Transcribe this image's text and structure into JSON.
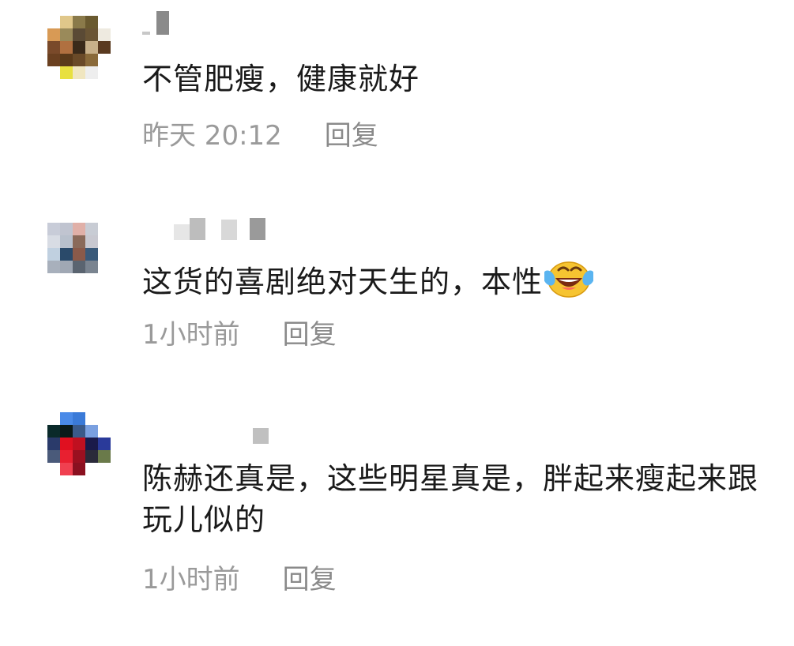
{
  "comments": [
    {
      "text": "不管肥瘦，健康就好",
      "time": "昨天 20:12",
      "reply_label": "回复",
      "avatar_colors": [
        "#ffffff",
        "#e0c78a",
        "#8a7a4a",
        "#6a5a30",
        "#ffffff",
        "#ffffff",
        "#d89a55",
        "#9a8a5a",
        "#5a4a35",
        "#6a5535",
        "#eeeae0",
        "#ffffff",
        "#7a4a2a",
        "#b07040",
        "#3a2a1a",
        "#c8b08a",
        "#5a3a20",
        "#ffffff",
        "#6a4020",
        "#5a3a1a",
        "#6a4a28",
        "#8a6a3a",
        "#ffffff",
        "#ffffff",
        "#ffffff",
        "#e8e040",
        "#f0e6c0",
        "#eeeeee",
        "#ffffff",
        "#ffffff",
        "#ffffff",
        "#ffffff",
        "#ffffff",
        "#ffffff",
        "#ffffff",
        "#ffffff"
      ]
    },
    {
      "text": "这货的喜剧绝对天生的，本性",
      "emoji": "laughing-crying-emoji",
      "time": "1小时前",
      "reply_label": "回复",
      "avatar_colors": [
        "#c8ccd8",
        "#c0c4d0",
        "#e0b0a8",
        "#c8ccd4",
        "#ffffff",
        "#ffffff",
        "#d8dce4",
        "#b8c0cc",
        "#8a6a5a",
        "#c8c8d0",
        "#ffffff",
        "#ffffff",
        "#c0d0e0",
        "#2a4a6a",
        "#8a5a4a",
        "#3a5a7a",
        "#ffffff",
        "#ffffff",
        "#a8b0bc",
        "#a0a8b4",
        "#5a6470",
        "#7a8490",
        "#ffffff",
        "#ffffff",
        "#ffffff",
        "#ffffff",
        "#ffffff",
        "#ffffff",
        "#ffffff",
        "#ffffff",
        "#ffffff",
        "#ffffff",
        "#ffffff",
        "#ffffff",
        "#ffffff",
        "#ffffff"
      ]
    },
    {
      "text": "陈赫还真是，这些明星真是，胖起来瘦起来跟玩儿似的",
      "time": "1小时前",
      "reply_label": "回复",
      "avatar_colors": [
        "#ffffff",
        "#4a8ae8",
        "#3a7ad8",
        "#ffffff",
        "#ffffff",
        "#ffffff",
        "#0a2a2a",
        "#0a1a1a",
        "#3a5a8a",
        "#7aa0e0",
        "#ffffff",
        "#ffffff",
        "#2a3a6a",
        "#e01020",
        "#c01020",
        "#1a1a4a",
        "#2a3a9a",
        "#ffffff",
        "#4a5a7a",
        "#e82030",
        "#9a1020",
        "#2a2a3a",
        "#6a7a4a",
        "#ffffff",
        "#ffffff",
        "#f04050",
        "#8a1020",
        "#ffffff",
        "#ffffff",
        "#ffffff",
        "#ffffff",
        "#ffffff",
        "#ffffff",
        "#ffffff",
        "#ffffff",
        "#ffffff"
      ]
    }
  ]
}
